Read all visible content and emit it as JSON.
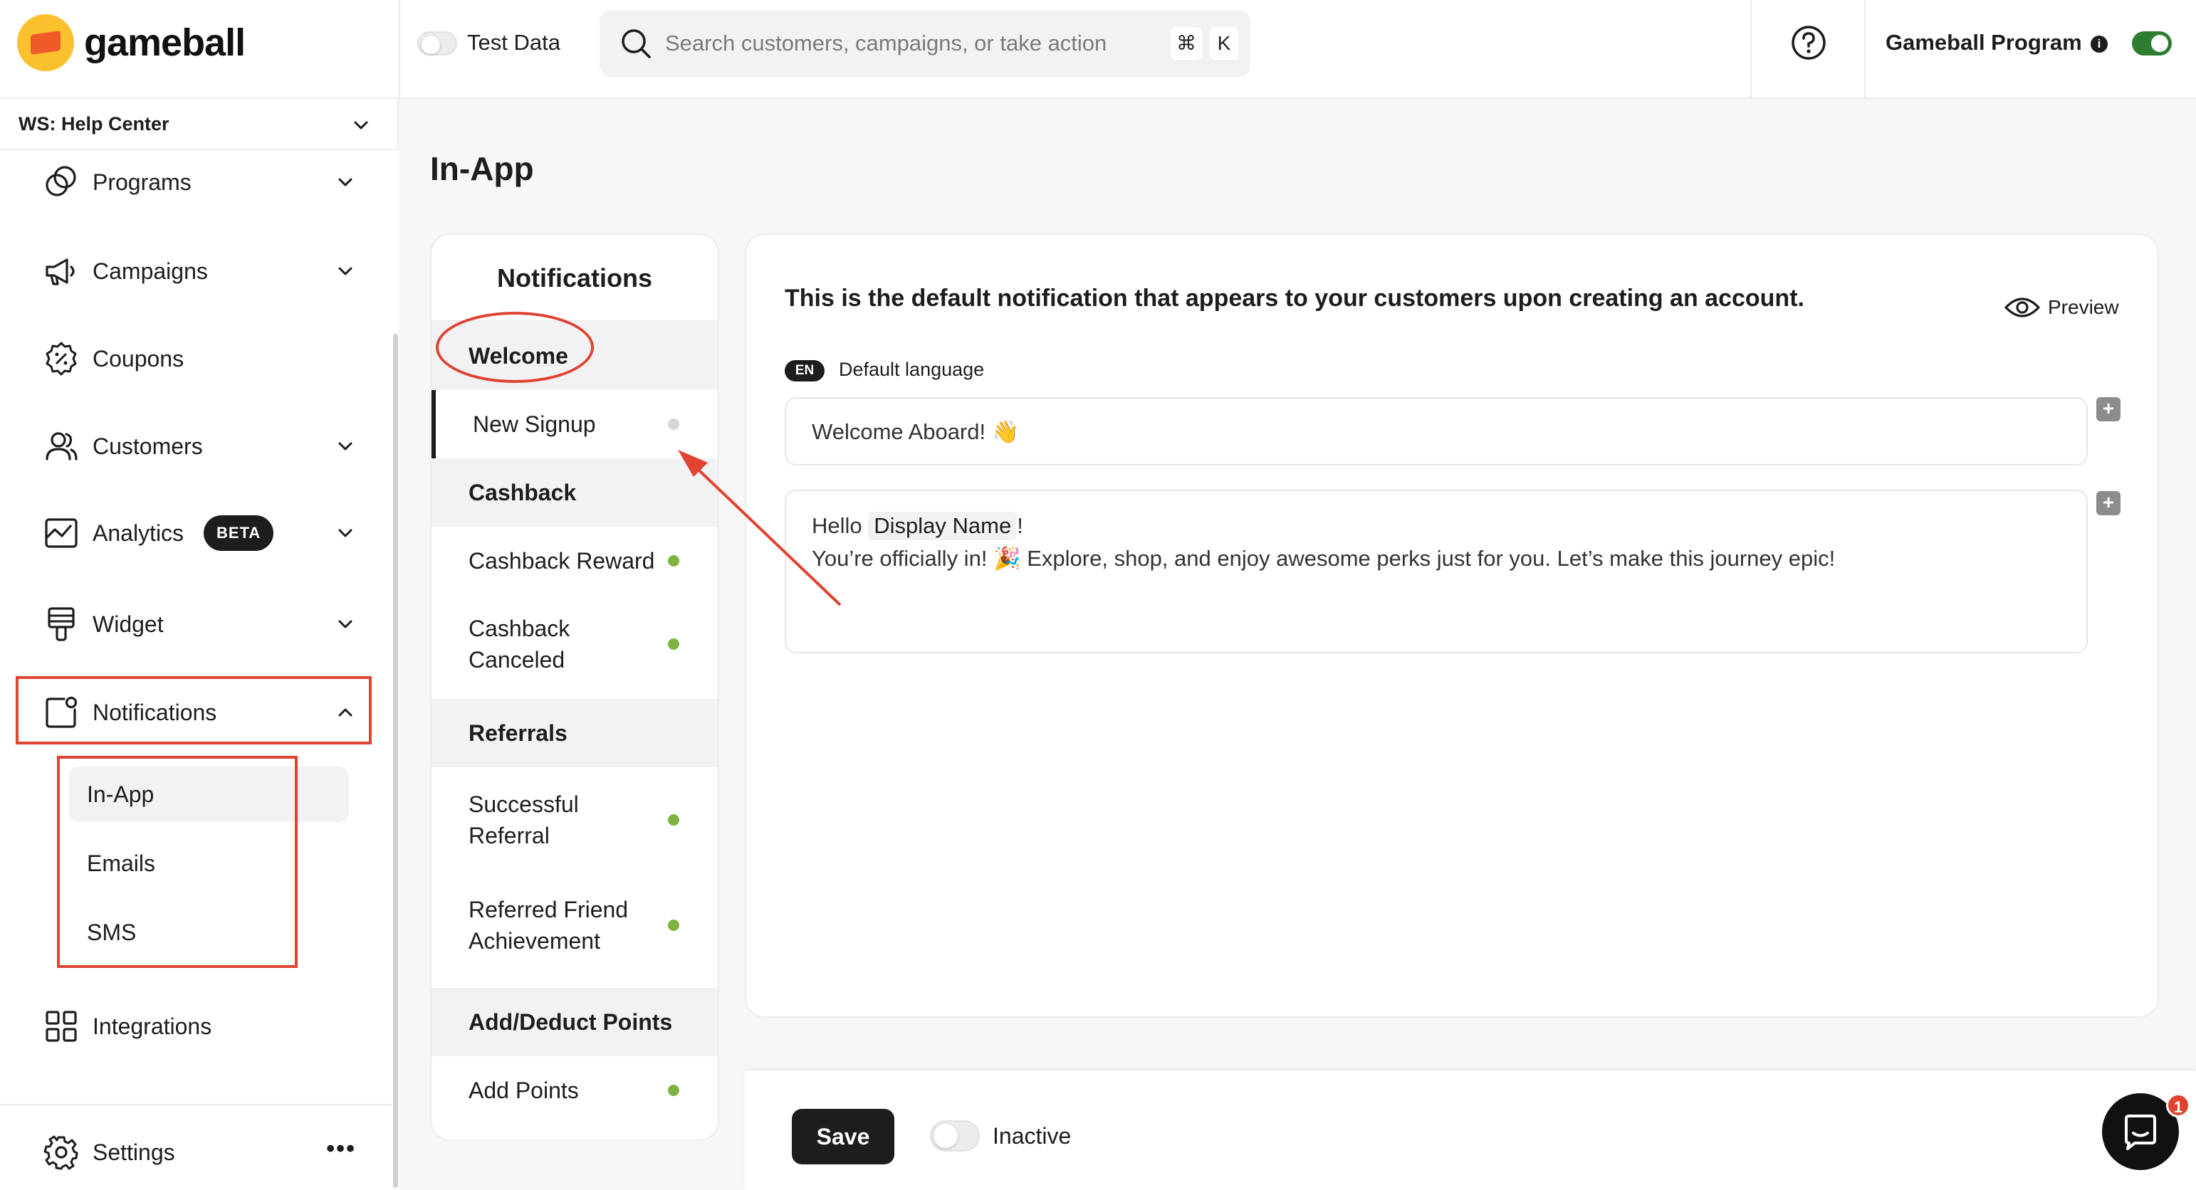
{
  "brand": {
    "logo_text": "gameball",
    "logo_color": "#fbc02d",
    "logo_accent": "#f05a28"
  },
  "topbar": {
    "test_data_label": "Test Data",
    "test_data_on": false,
    "search": {
      "placeholder": "Search customers, campaigns, or take action",
      "value": "",
      "shortcut_cmd": "⌘",
      "shortcut_key": "K"
    },
    "help_icon": "question-circle-icon",
    "program_label": "Gameball Program",
    "program_info_icon": "i",
    "program_enabled": true
  },
  "sidebar": {
    "workspace": "WS: Help Center",
    "items": [
      {
        "label": "Programs",
        "icon": "programs-icon",
        "expandable": true
      },
      {
        "label": "Campaigns",
        "icon": "megaphone-icon",
        "expandable": true
      },
      {
        "label": "Coupons",
        "icon": "coupon-icon",
        "expandable": false
      },
      {
        "label": "Customers",
        "icon": "users-icon",
        "expandable": true
      },
      {
        "label": "Analytics",
        "icon": "analytics-icon",
        "expandable": true,
        "badge": "BETA"
      },
      {
        "label": "Widget",
        "icon": "widget-icon",
        "expandable": true
      },
      {
        "label": "Notifications",
        "icon": "notification-icon",
        "expanded": true
      },
      {
        "label": "Integrations",
        "icon": "grid-icon",
        "expandable": false
      }
    ],
    "notifications_sub": [
      {
        "label": "In-App",
        "active": true
      },
      {
        "label": "Emails",
        "active": false
      },
      {
        "label": "SMS",
        "active": false
      }
    ],
    "settings_label": "Settings",
    "more_icon": "•••"
  },
  "main": {
    "page_title": "In-App",
    "notifications_panel": {
      "title": "Notifications",
      "categories": [
        {
          "name": "Welcome",
          "items": [
            {
              "label": "New Signup",
              "status": "inactive"
            }
          ]
        },
        {
          "name": "Cashback",
          "items": [
            {
              "label": "Cashback Reward",
              "status": "active"
            },
            {
              "label": "Cashback\nCanceled",
              "status": "active"
            }
          ]
        },
        {
          "name": "Referrals",
          "items": [
            {
              "label": "Successful\nReferral",
              "status": "active"
            },
            {
              "label": "Referred Friend\nAchievement",
              "status": "active"
            }
          ]
        },
        {
          "name": "Add/Deduct Points",
          "items": [
            {
              "label": "Add Points",
              "status": "active"
            }
          ]
        }
      ],
      "status_colors": {
        "active": "#7cb342",
        "inactive": "#d6d6d6"
      }
    },
    "editor": {
      "description": "This is the default notification that appears to your customers upon creating an account.",
      "preview_label": "Preview",
      "language_code": "EN",
      "language_label": "Default language",
      "title_value": "Welcome Aboard! 👋",
      "body_greeting": "Hello",
      "body_variable": "Display Name",
      "body_greeting_end": "!",
      "body_line2": "You’re officially in! 🎉 Explore, shop, and enjoy awesome perks just for you. Let’s make this journey epic!",
      "add_symbol": "+"
    },
    "footer": {
      "save_label": "Save",
      "status_label": "Inactive",
      "status_on": false
    }
  },
  "chat": {
    "badge_count": "1"
  },
  "annotation_color": "#e0432f"
}
